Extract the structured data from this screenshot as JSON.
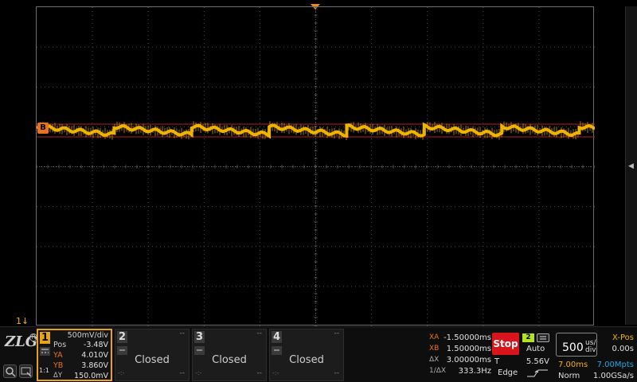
{
  "colors": {
    "ch1": "#f0b400",
    "ch1_marker": "#e8731a",
    "stop": "#d8141c",
    "trigger_source": "#b5e21e",
    "mpts": "#22a8e0"
  },
  "waveform": {
    "marker_label": "B",
    "ref_marker": "1↓"
  },
  "side_handle": {
    "glyph": "◀"
  },
  "logo": {
    "text": "ZLG",
    "registered": "R"
  },
  "tools": [
    {
      "icon": "zoom-icon"
    },
    {
      "icon": "screen-icon"
    }
  ],
  "ch1": {
    "number": "1",
    "scale": "500mV/div",
    "coupling": "DC",
    "probe": "1:1",
    "pos_label": "Pos",
    "pos_value": "-3.48V",
    "ya_label": "YA",
    "ya_value": "4.010V",
    "yb_label": "YB",
    "yb_value": "3.860V",
    "dy_label": "ΔY",
    "dy_value": "150.0mV"
  },
  "closed_channels": [
    {
      "number": "2",
      "status": "Closed",
      "top": "--",
      "bottom": "--",
      "left": "-:-"
    },
    {
      "number": "3",
      "status": "Closed",
      "top": "--",
      "bottom": "--",
      "left": "-:-"
    },
    {
      "number": "4",
      "status": "Closed",
      "top": "--",
      "bottom": "--",
      "left": "-:-"
    }
  ],
  "cursors": {
    "xa_label": "XA",
    "xa_value": "-1.50000ms",
    "xb_label": "XB",
    "xb_value": "1.50000ms",
    "dx_label": "ΔX",
    "dx_value": "3.00000ms",
    "freq_label": "1/ΔX",
    "freq_value": "333.3Hz"
  },
  "trigger": {
    "run_state": "Stop",
    "source": "2",
    "mode": "Auto",
    "t_label": "T",
    "level": "5.56V",
    "type": "Edge"
  },
  "timebase": {
    "value": "500",
    "unit_top": "us/",
    "unit_bottom": "div",
    "xpos_label": "X-Pos",
    "xpos_value": "0.00s",
    "length": "7.00ms",
    "mpts": "7.00Mpts",
    "acq_mode": "Norm",
    "sample_rate": "1.00GSa/s"
  }
}
